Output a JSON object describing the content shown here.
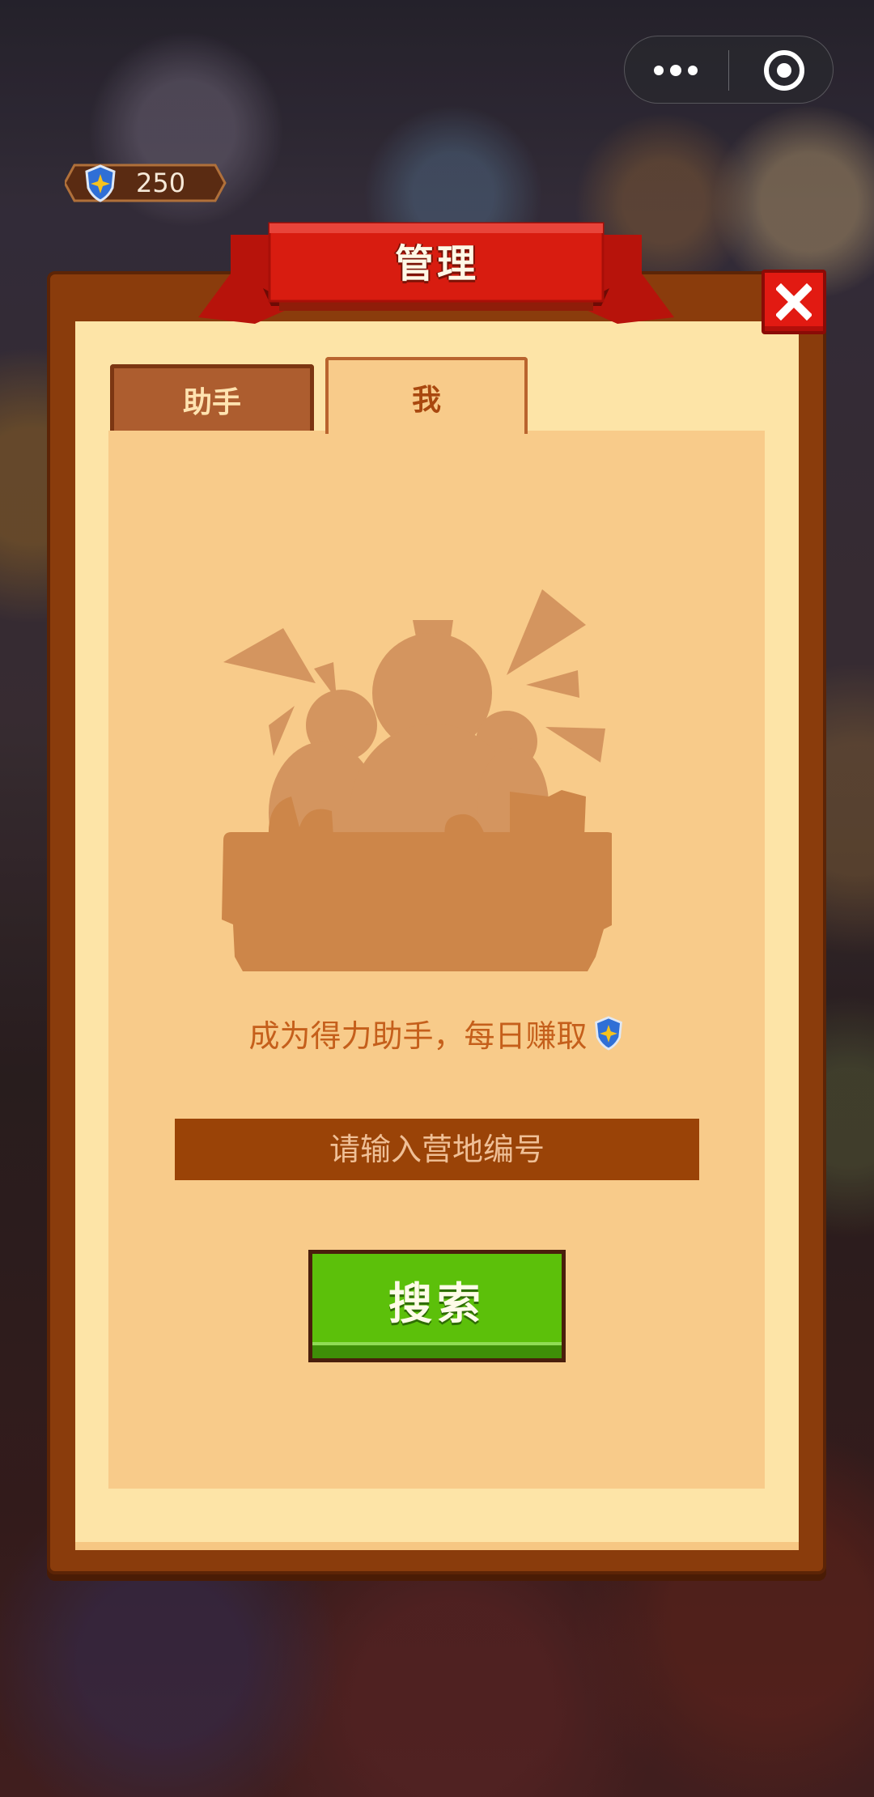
{
  "status": {
    "currency_amount": "250",
    "currency_icon": "shield-star-icon"
  },
  "miniprogram_capsule": {
    "more_icon": "more-dots-icon",
    "close_icon": "target-circle-icon"
  },
  "dialog": {
    "title": "管理",
    "close_icon": "close-x-icon",
    "tabs": [
      {
        "label": "助手",
        "active": false
      },
      {
        "label": "我",
        "active": true
      }
    ],
    "illustration_icon": "empty-camp-silhouette",
    "prompt_text": "成为得力助手，每日赚取",
    "prompt_icon": "shield-star-icon",
    "search_placeholder": "请输入营地编号",
    "search_value": "",
    "search_button_label": "搜索"
  },
  "colors": {
    "frame": "#8a3c0c",
    "paper": "#fde4a7",
    "content": "#f8cb8a",
    "ribbon": "#d81c10",
    "close_button": "#e21a12",
    "search_button": "#5cc00a",
    "input_bg": "#9a4307"
  }
}
